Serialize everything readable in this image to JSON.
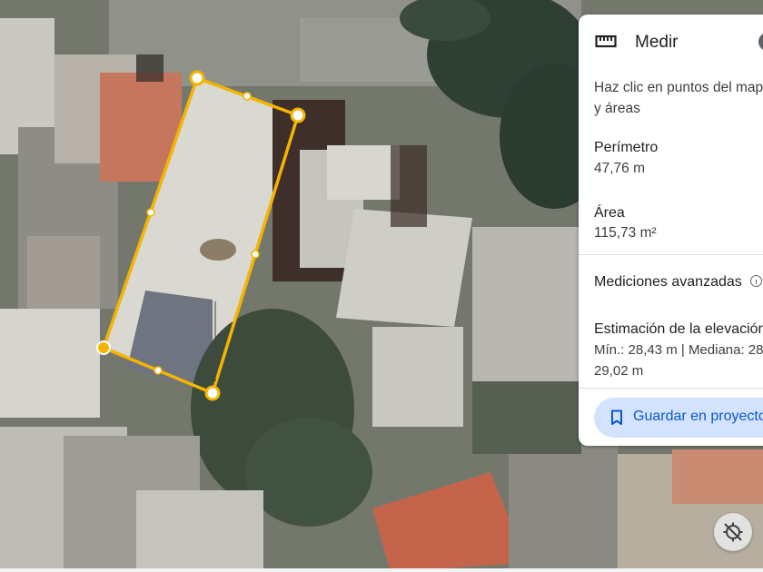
{
  "panel": {
    "title": "Medir",
    "title_icon": "ruler-icon",
    "close_icon": "close-icon",
    "hint_line1": "Haz clic en puntos del mapa",
    "hint_line2": "y áreas",
    "perimeter_label": "Perímetro",
    "perimeter_value": "47,76 m",
    "area_label": "Área",
    "area_value": "115,73 m²",
    "advanced_label": "Mediciones avanzadas",
    "elevation_label": "Estimación de la elevación",
    "elevation_line1": "Mín.: 28,43 m | Mediana: 28",
    "elevation_line2": "29,02 m",
    "save_label": "Guardar en proyecto",
    "accent_color": "#f4b400"
  },
  "map": {
    "compass_icon": "compass-off-icon"
  }
}
